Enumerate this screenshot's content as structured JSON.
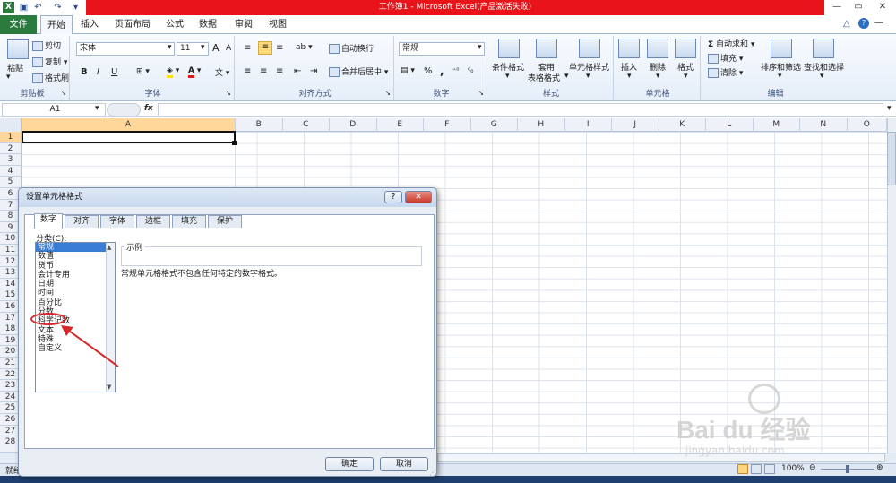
{
  "title_bar": {
    "title": "工作簿1 - Microsoft Excel(产品激活失败)"
  },
  "menu": {
    "file": "文件",
    "tabs": [
      "开始",
      "插入",
      "页面布局",
      "公式",
      "数据",
      "审阅",
      "视图"
    ]
  },
  "ribbon": {
    "clipboard": {
      "paste": "粘贴",
      "cut": "剪切",
      "copy": "复制",
      "format_painter": "格式刷",
      "label": "剪贴板"
    },
    "font": {
      "name": "宋体",
      "size": "11",
      "bold": "B",
      "italic": "I",
      "underline": "U",
      "grow": "A",
      "shrink": "A",
      "label": "字体"
    },
    "alignment": {
      "wrap": "自动换行",
      "merge": "合并后居中",
      "label": "对齐方式"
    },
    "number": {
      "format": "常规",
      "percent": "%",
      "comma": ",",
      "label": "数字"
    },
    "styles": {
      "conditional": "条件格式",
      "table_line1": "套用",
      "table_line2": "表格格式",
      "cell_styles": "单元格样式",
      "label": "样式"
    },
    "cells": {
      "insert": "插入",
      "delete": "删除",
      "format": "格式",
      "label": "单元格"
    },
    "editing": {
      "autosum": "自动求和",
      "fill": "填充",
      "clear": "清除",
      "sort": "排序和筛选",
      "find": "查找和选择",
      "label": "编辑"
    }
  },
  "formula_bar": {
    "name_box": "A1",
    "fx": "fx",
    "value": ""
  },
  "grid": {
    "columns": [
      "A",
      "B",
      "C",
      "D",
      "E",
      "F",
      "G",
      "H",
      "I",
      "J",
      "K",
      "L",
      "M",
      "N",
      "O"
    ],
    "rows": [
      "1",
      "2",
      "3",
      "4",
      "5",
      "6",
      "7",
      "8",
      "9",
      "10",
      "11",
      "12",
      "13",
      "14",
      "15",
      "16",
      "17",
      "18",
      "19",
      "20",
      "21",
      "22",
      "23",
      "24",
      "25",
      "26",
      "27",
      "28"
    ]
  },
  "status": {
    "ready": "就绪",
    "zoom": "100%"
  },
  "dialog": {
    "title": "设置单元格格式",
    "help": "?",
    "close": "✕",
    "tabs": [
      "数字",
      "对齐",
      "字体",
      "边框",
      "填充",
      "保护"
    ],
    "category_label": "分类(C):",
    "categories": [
      "常规",
      "数值",
      "货币",
      "会计专用",
      "日期",
      "时间",
      "百分比",
      "分数",
      "科学记数",
      "文本",
      "特殊",
      "自定义"
    ],
    "selected_category": "常规",
    "sample_label": "示例",
    "description": "常规单元格格式不包含任何特定的数字格式。",
    "ok": "确定",
    "cancel": "取消"
  },
  "annotation": {
    "highlight": "文本",
    "color": "#d8262c"
  },
  "watermark": {
    "brand": "Bai du 经验",
    "url": "jingyan.baidu.com"
  }
}
